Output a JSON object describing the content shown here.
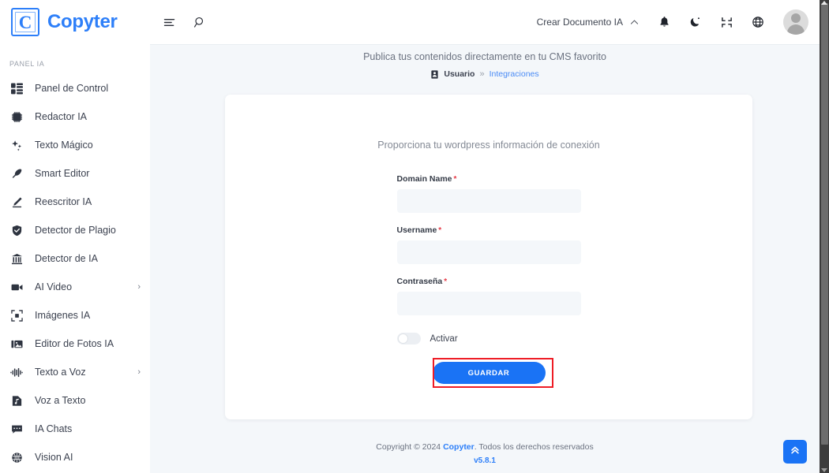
{
  "brand": {
    "logo_letter": "C",
    "name": "Copyter"
  },
  "header": {
    "menu_icon": "hamburger-menu-icon",
    "search_icon": "search-icon",
    "create_document_label": "Crear Documento IA",
    "chevron_icon": "chevron-up-icon",
    "notification_icon": "bell-icon",
    "theme_icon": "moon-icon",
    "fullscreen_icon": "collapse-icon",
    "language_icon": "globe-icon",
    "avatar_icon": "user-avatar"
  },
  "sidebar": {
    "section_label": "PANEL IA",
    "items": [
      {
        "label": "Panel de Control",
        "icon": "dashboard-icon",
        "has_submenu": false
      },
      {
        "label": "Redactor IA",
        "icon": "ai-chip-icon",
        "has_submenu": false
      },
      {
        "label": "Texto Mágico",
        "icon": "sparkles-icon",
        "has_submenu": false
      },
      {
        "label": "Smart Editor",
        "icon": "feather-icon",
        "has_submenu": false
      },
      {
        "label": "Reescritor IA",
        "icon": "pencil-icon",
        "has_submenu": false
      },
      {
        "label": "Detector de Plagio",
        "icon": "shield-check-icon",
        "has_submenu": false
      },
      {
        "label": "Detector de IA",
        "icon": "bank-icon",
        "has_submenu": false
      },
      {
        "label": "AI Video",
        "icon": "video-camera-icon",
        "has_submenu": true
      },
      {
        "label": "Imágenes IA",
        "icon": "image-frame-icon",
        "has_submenu": false
      },
      {
        "label": "Editor de Fotos IA",
        "icon": "photo-editor-icon",
        "has_submenu": false
      },
      {
        "label": "Texto a Voz",
        "icon": "waveform-icon",
        "has_submenu": true
      },
      {
        "label": "Voz a Texto",
        "icon": "audio-file-icon",
        "has_submenu": false
      },
      {
        "label": "IA Chats",
        "icon": "chat-bubble-icon",
        "has_submenu": false
      },
      {
        "label": "Vision AI",
        "icon": "brain-icon",
        "has_submenu": false
      }
    ],
    "submenu_caret": "›"
  },
  "main": {
    "subtitle": "Publica tus contenidos directamente en tu CMS favorito",
    "breadcrumb": {
      "icon": "id-card-icon",
      "root": "Usuario",
      "separator": "»",
      "current": "Integraciones"
    },
    "card": {
      "title": "Proporciona tu wordpress información de conexión",
      "fields": [
        {
          "label": "Domain Name",
          "required_mark": "*",
          "value": "",
          "placeholder": ""
        },
        {
          "label": "Username",
          "required_mark": "*",
          "value": "",
          "placeholder": ""
        },
        {
          "label": "Contraseña",
          "required_mark": "*",
          "value": "",
          "placeholder": ""
        }
      ],
      "toggle": {
        "label": "Activar",
        "state": "off"
      },
      "save_label": "GUARDAR"
    }
  },
  "footer": {
    "copyright_prefix": "Copyright © 2024 ",
    "brand": "Copyter",
    "copyright_suffix": ". Todos los derechos reservados",
    "version": "v5.8.1"
  },
  "scroll_top": {
    "icon": "double-chevron-up-icon"
  },
  "colors": {
    "accent": "#2d7ff9",
    "button": "#1a73f5",
    "highlight": "#ee1c25",
    "page_bg": "#f4f7fa",
    "required": "#e63946"
  }
}
